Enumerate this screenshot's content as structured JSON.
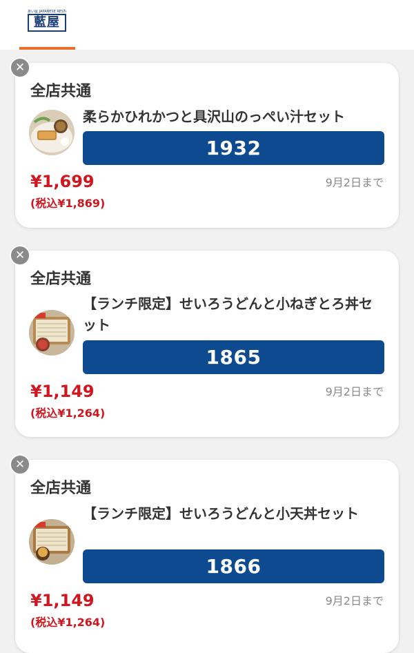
{
  "header": {
    "logo_subtext": "あい屋 JAPANESE RESTAURANT",
    "logo_text": "藍屋",
    "accent_color": "#e8702a"
  },
  "coupons": [
    {
      "store_label": "全店共通",
      "item_name": "柔らかひれかつと具沢山のっぺい汁セット",
      "code": "1932",
      "price": "¥1,699",
      "price_tax": "(税込¥1,869)",
      "expiry": "9月2日まで"
    },
    {
      "store_label": "全店共通",
      "item_name": "【ランチ限定】せいろうどんと小ねぎとろ丼セット",
      "code": "1865",
      "price": "¥1,149",
      "price_tax": "(税込¥1,264)",
      "expiry": "9月2日まで"
    },
    {
      "store_label": "全店共通",
      "item_name": "【ランチ限定】せいろうどんと小天丼セット",
      "code": "1866",
      "price": "¥1,149",
      "price_tax": "(税込¥1,264)",
      "expiry": "9月2日まで"
    }
  ],
  "colors": {
    "code_button": "#0e4a8f",
    "price": "#d0161e",
    "close_button": "#8a8a8a"
  },
  "icons": {
    "close": "close-icon"
  }
}
